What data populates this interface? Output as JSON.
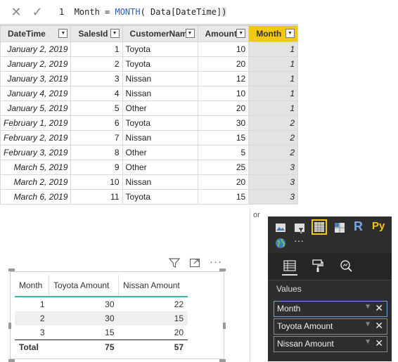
{
  "formula": {
    "line_number": "1",
    "before_fn": "Month = ",
    "fn_name": "MONTH",
    "after_fn": "( Data[DateTime]",
    "close_paren": ")"
  },
  "grid": {
    "columns": [
      "DateTime",
      "SalesId",
      "CustomerName",
      "Amount",
      "Month"
    ],
    "rows": [
      [
        "January 2, 2019",
        "1",
        "Toyota",
        "10",
        "1"
      ],
      [
        "January 2, 2019",
        "2",
        "Toyota",
        "20",
        "1"
      ],
      [
        "January 3, 2019",
        "3",
        "Nissan",
        "12",
        "1"
      ],
      [
        "January 4, 2019",
        "4",
        "Nissan",
        "10",
        "1"
      ],
      [
        "January 5, 2019",
        "5",
        "Other",
        "20",
        "1"
      ],
      [
        "February 1, 2019",
        "6",
        "Toyota",
        "30",
        "2"
      ],
      [
        "February 2, 2019",
        "7",
        "Nissan",
        "15",
        "2"
      ],
      [
        "February 3, 2019",
        "8",
        "Other",
        "5",
        "2"
      ],
      [
        "March 5, 2019",
        "9",
        "Other",
        "25",
        "3"
      ],
      [
        "March 2, 2019",
        "10",
        "Nissan",
        "20",
        "3"
      ],
      [
        "March 6, 2019",
        "11",
        "Toyota",
        "15",
        "3"
      ]
    ]
  },
  "stray_text": "or",
  "matrix": {
    "headers": [
      "Month",
      "Toyota Amount",
      "Nissan Amount"
    ],
    "rows": [
      [
        "1",
        "30",
        "22"
      ],
      [
        "2",
        "30",
        "15"
      ],
      [
        "3",
        "15",
        "20"
      ]
    ],
    "total": [
      "Total",
      "75",
      "57"
    ]
  },
  "viz_icons": [
    "filter-icon",
    "focus-mode-icon",
    "more-options-icon"
  ],
  "pane": {
    "r_label": "R",
    "py_label": "Py",
    "more_label": "···",
    "values_label": "Values",
    "wells": [
      "Month",
      "Toyota Amount",
      "Nissan Amount"
    ],
    "accent": "#f2c811"
  }
}
